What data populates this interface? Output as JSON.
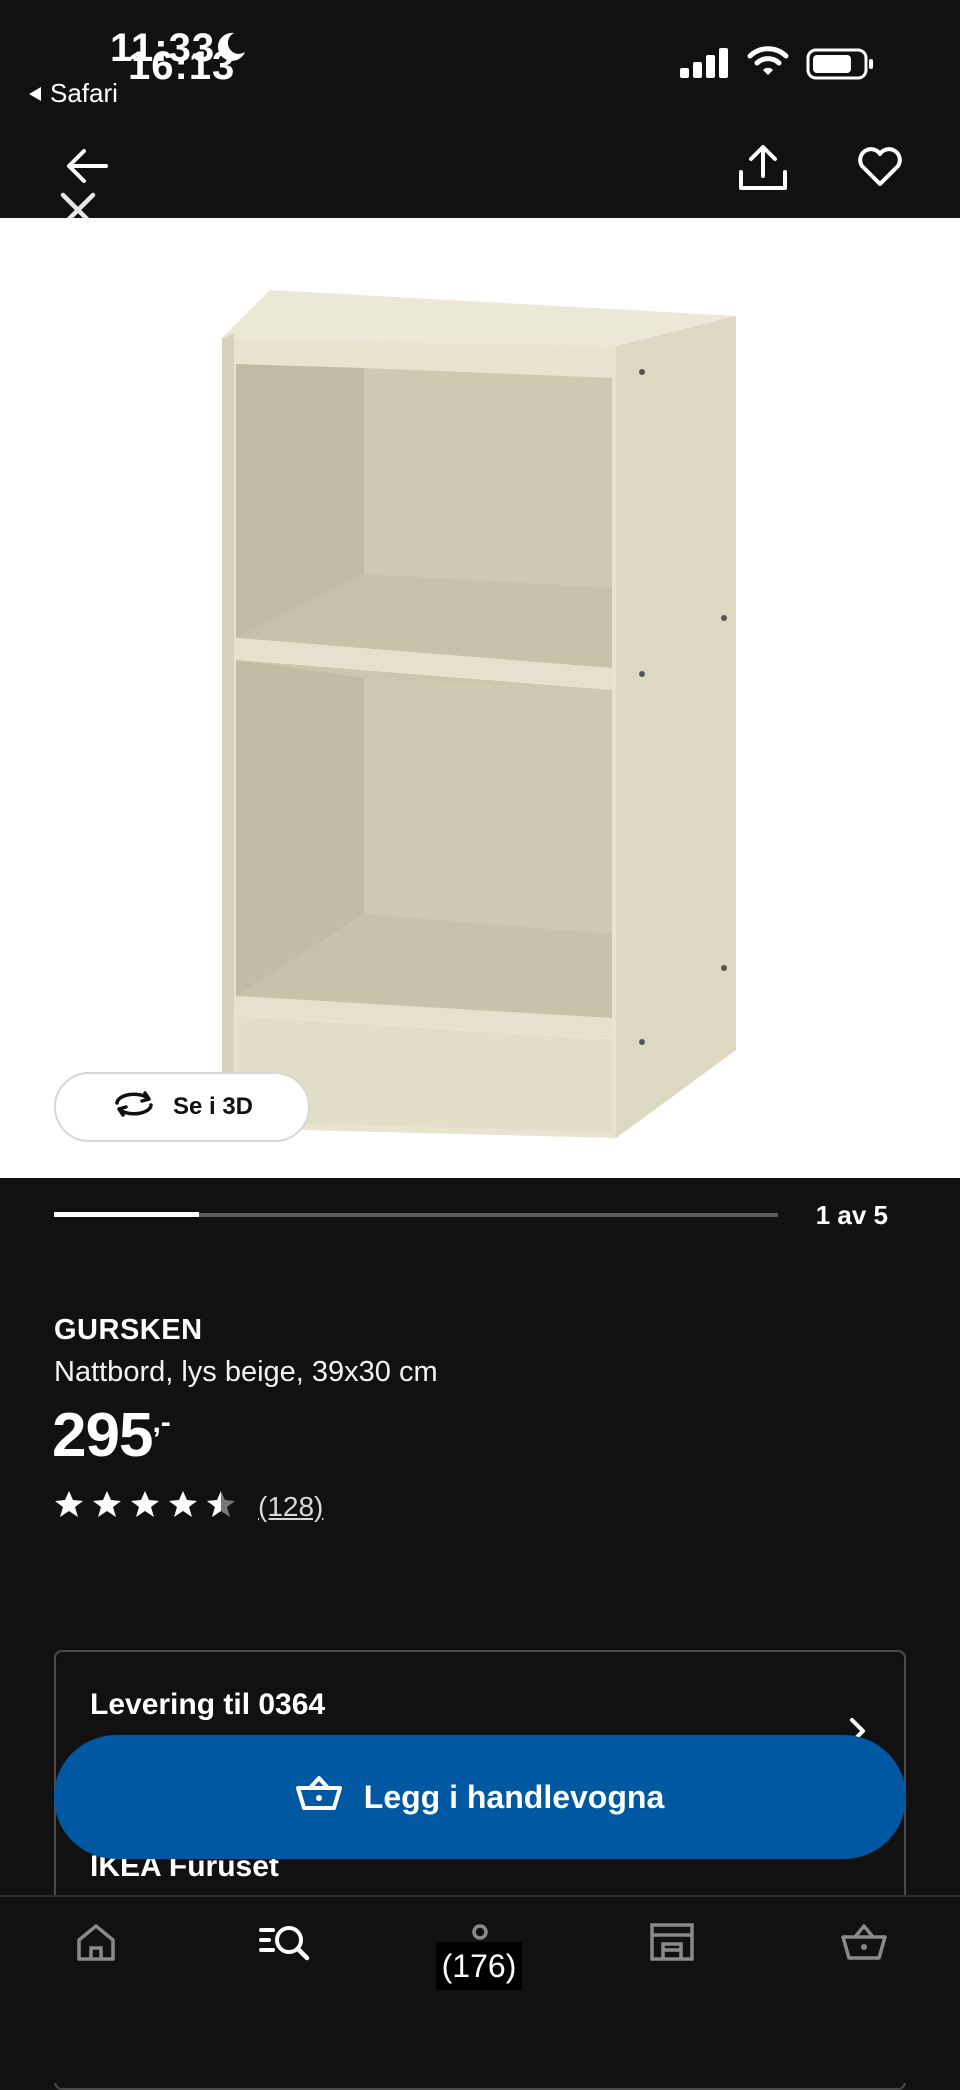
{
  "status_bar": {
    "time_a": "11:33",
    "time_b": "16:13",
    "back_app": "Safari"
  },
  "image": {
    "view_3d_label": "Se i 3D",
    "progress_fraction": 0.2,
    "progress_label": "1 av 5"
  },
  "product": {
    "name": "GURSKEN",
    "description": "Nattbord, lys beige, 39x30 cm",
    "price": "295",
    "price_suffix": ",-",
    "rating": 4.5,
    "rating_count": "(128)"
  },
  "delivery": {
    "title": "Levering til 0364",
    "store": "IKEA Furuset"
  },
  "cta": {
    "add_to_cart": "Legg i handlevogna"
  },
  "tab_bar": {
    "items": [
      "home-icon",
      "search-icon",
      "profile-icon",
      "store-icon",
      "cart-icon"
    ],
    "profile_badge": "(176)"
  },
  "colors": {
    "background": "#111111",
    "accent": "#0058a3",
    "product": "#e8e3cf"
  }
}
